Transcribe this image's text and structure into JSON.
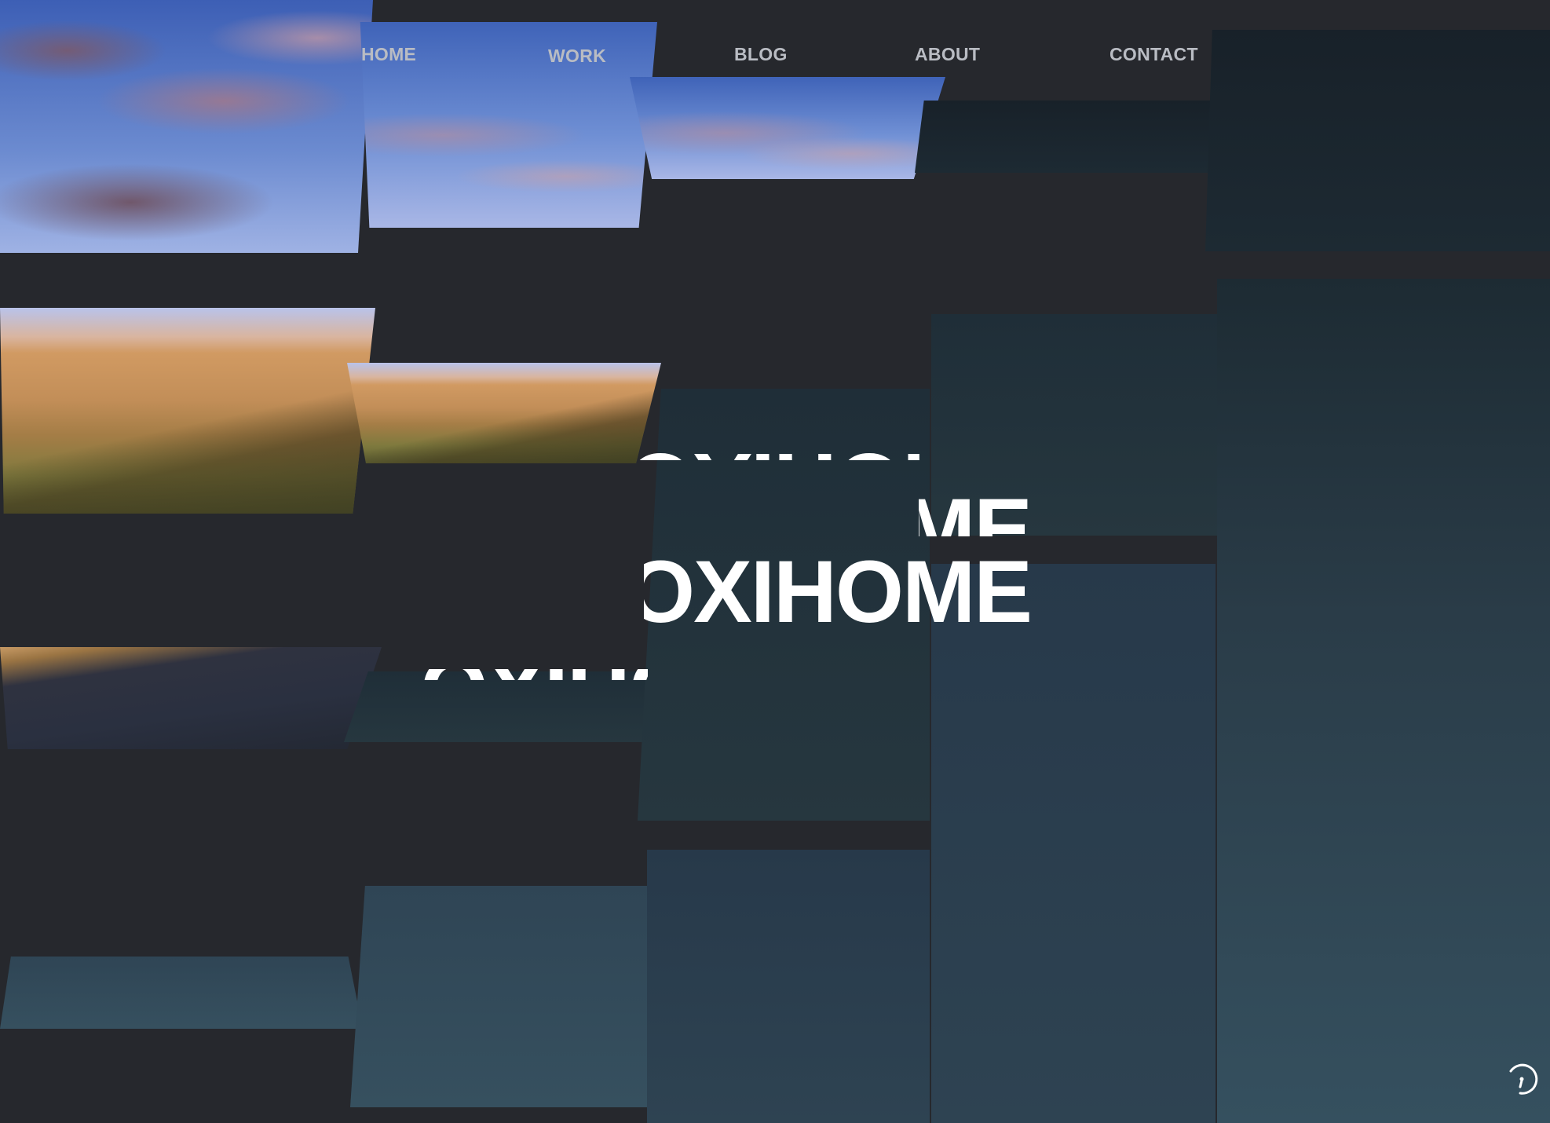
{
  "nav": {
    "items": [
      {
        "label": "HOME"
      },
      {
        "label": "WORK"
      },
      {
        "label": "BLOG"
      },
      {
        "label": "ABOUT"
      },
      {
        "label": "CONTACT"
      }
    ]
  },
  "hero": {
    "headline": "OXIHOME"
  },
  "colors": {
    "background": "#26282d",
    "nav_text": "#b9bcc3",
    "headline": "#ffffff"
  },
  "icons": {
    "loader": "loading-spinner-icon"
  }
}
